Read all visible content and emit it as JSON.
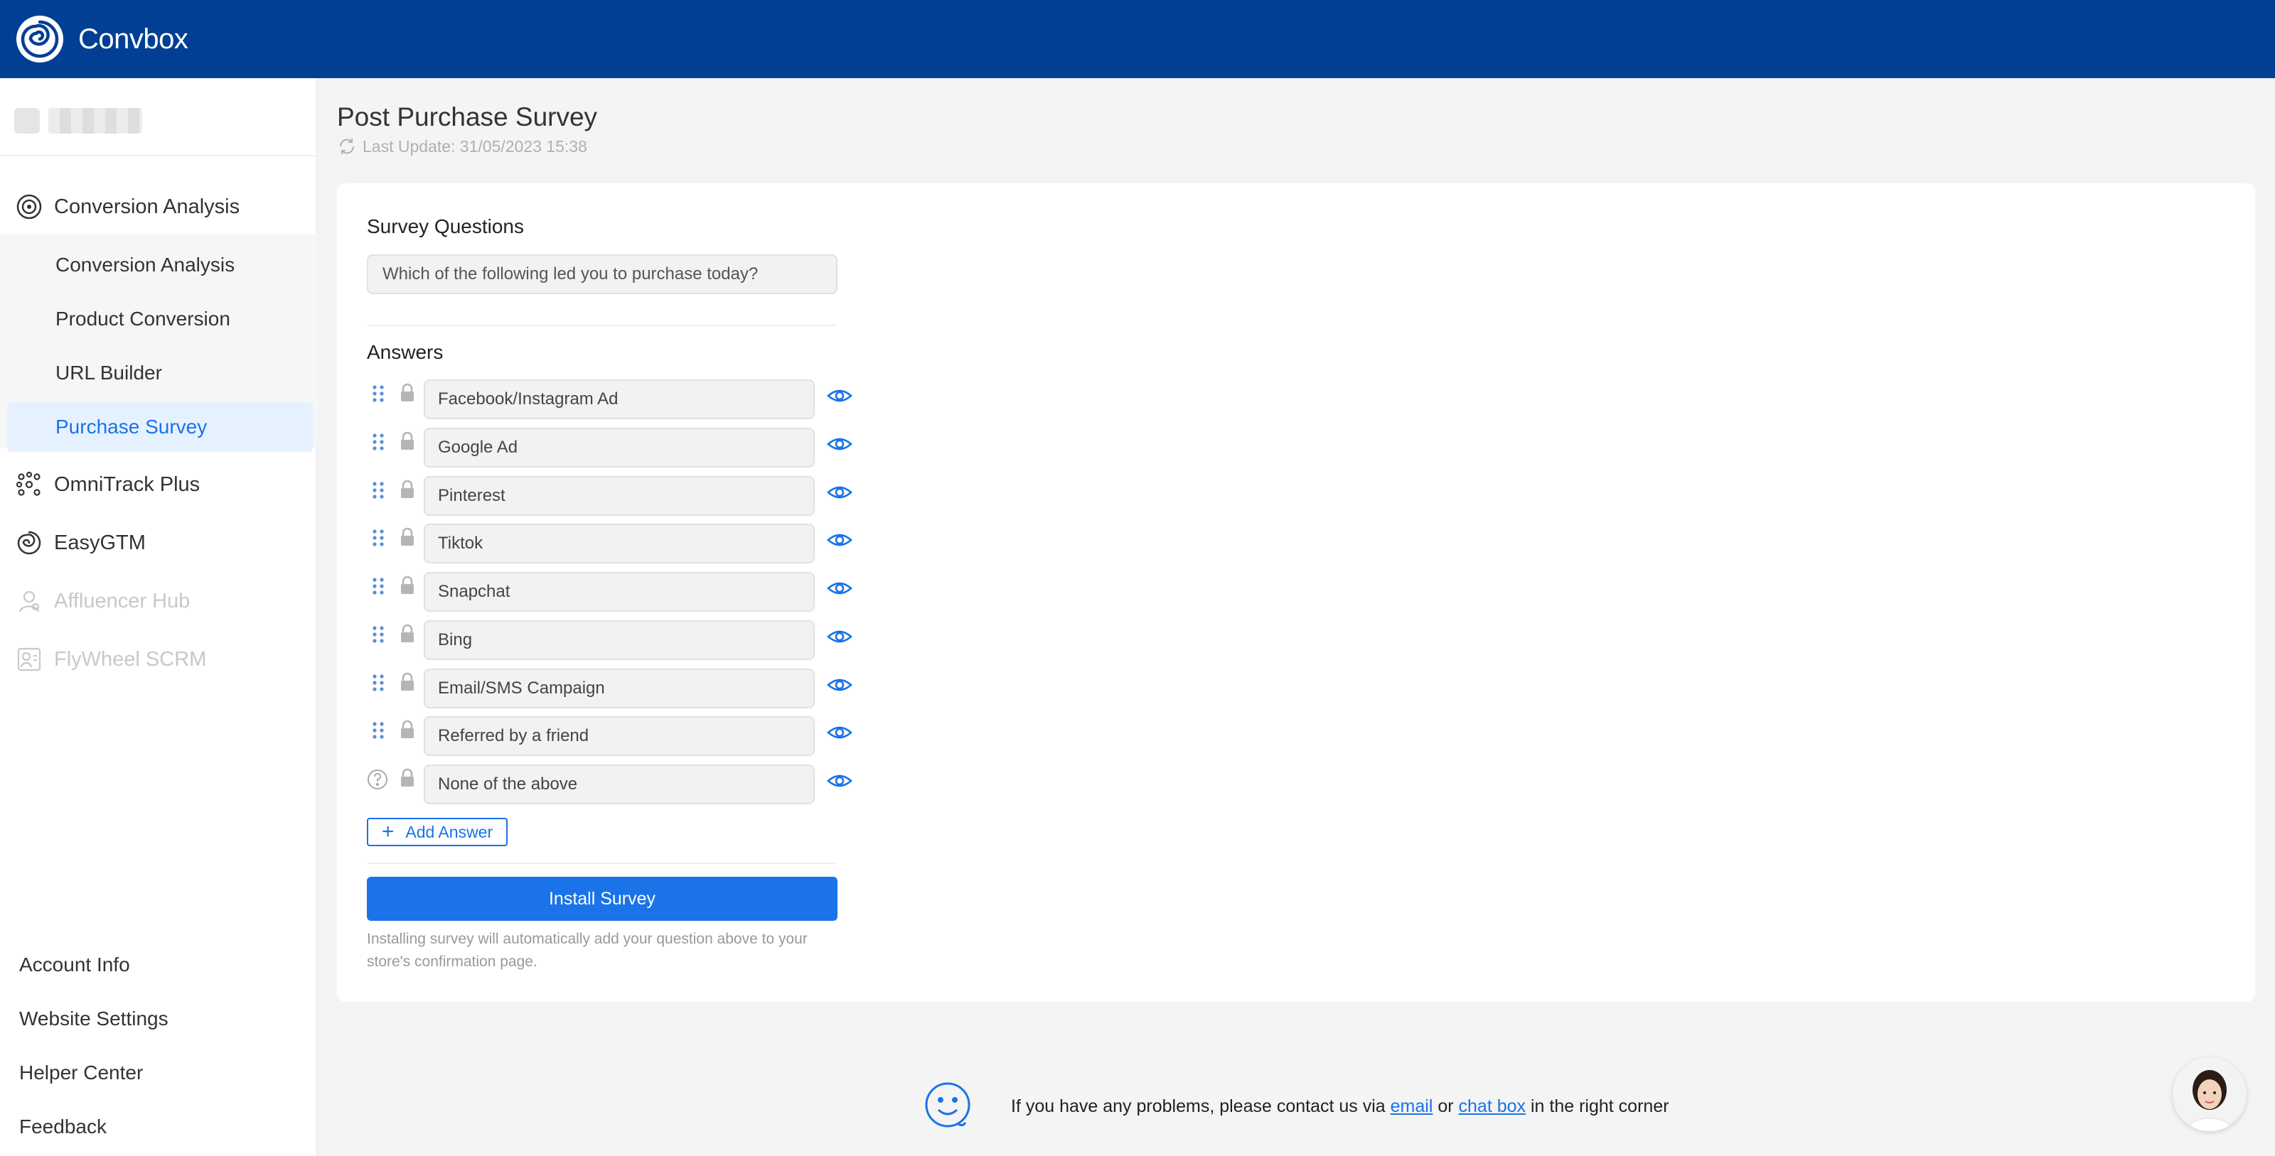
{
  "app": {
    "name": "Convbox"
  },
  "sidebar": {
    "groups": [
      {
        "label": "Conversion Analysis",
        "icon": "target-icon",
        "enabled": true
      },
      {
        "label": "OmniTrack Plus",
        "icon": "network-icon",
        "enabled": true
      },
      {
        "label": "EasyGTM",
        "icon": "swirl-icon",
        "enabled": true
      },
      {
        "label": "Affluencer Hub",
        "icon": "person-icon",
        "enabled": false
      },
      {
        "label": "FlyWheel SCRM",
        "icon": "contact-card-icon",
        "enabled": false
      }
    ],
    "sub_items": [
      {
        "label": "Conversion Analysis",
        "active": false
      },
      {
        "label": "Product Conversion",
        "active": false
      },
      {
        "label": "URL Builder",
        "active": false
      },
      {
        "label": "Purchase Survey",
        "active": true
      }
    ],
    "bottom_links": [
      "Account Info",
      "Website Settings",
      "Helper Center",
      "Feedback"
    ]
  },
  "page": {
    "title": "Post Purchase Survey",
    "last_update": "Last Update: 31/05/2023 15:38"
  },
  "survey": {
    "questions_label": "Survey Questions",
    "question": "Which of the following led you to purchase today?",
    "answers_label": "Answers",
    "answers": [
      "Facebook/Instagram Ad",
      "Google Ad",
      "Pinterest",
      "Tiktok",
      "Snapchat",
      "Bing",
      "Email/SMS Campaign",
      "Referred by a friend",
      "None of the above"
    ],
    "add_answer_label": "Add Answer",
    "install_label": "Install Survey",
    "install_note": "Installing survey will automatically add your question above to your store's confirmation page."
  },
  "footer": {
    "text_before": "If you have any problems, please contact us via",
    "email_link": "email",
    "text_middle": "or",
    "chat_link": "chat box",
    "text_after": "in the right corner"
  },
  "colors": {
    "topbar": "#003f93",
    "accent": "#1a73e8"
  }
}
